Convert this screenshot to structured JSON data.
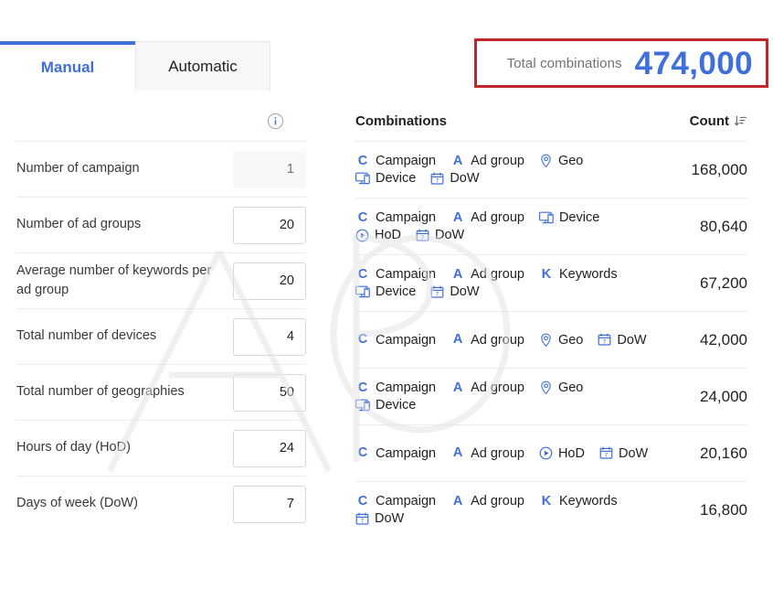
{
  "tabs": [
    {
      "label": "Manual",
      "active": true
    },
    {
      "label": "Automatic",
      "active": false
    }
  ],
  "summary": {
    "label": "Total combinations",
    "value": "474,000",
    "accent_color": "#3f6fd8",
    "highlight_border_color": "#c0272d"
  },
  "form": {
    "info_icon": "info-icon",
    "rows": [
      {
        "label": "Number of campaign",
        "value": "1",
        "readonly": true
      },
      {
        "label": "Number of ad groups",
        "value": "20",
        "readonly": false
      },
      {
        "label": "Average number of keywords per ad group",
        "value": "20",
        "readonly": false
      },
      {
        "label": "Total number of devices",
        "value": "4",
        "readonly": false
      },
      {
        "label": "Total number of geographies",
        "value": "50",
        "readonly": false
      },
      {
        "label": "Hours of day (HoD)",
        "value": "24",
        "readonly": false
      },
      {
        "label": "Days of week (DoW)",
        "value": "7",
        "readonly": false
      }
    ]
  },
  "table": {
    "columns": {
      "combinations": "Combinations",
      "count": "Count",
      "sort_icon": "sort-descending-icon"
    },
    "rows": [
      {
        "chips": [
          {
            "icon": "campaign-icon",
            "label": "Campaign"
          },
          {
            "icon": "ad-group-icon",
            "label": "Ad group"
          },
          {
            "icon": "geo-icon",
            "label": "Geo"
          },
          {
            "icon": "device-icon",
            "label": "Device"
          },
          {
            "icon": "dow-icon",
            "label": "DoW"
          }
        ],
        "count": "168,000"
      },
      {
        "chips": [
          {
            "icon": "campaign-icon",
            "label": "Campaign"
          },
          {
            "icon": "ad-group-icon",
            "label": "Ad group"
          },
          {
            "icon": "device-icon",
            "label": "Device"
          },
          {
            "icon": "hod-icon",
            "label": "HoD"
          },
          {
            "icon": "dow-icon",
            "label": "DoW"
          }
        ],
        "count": "80,640"
      },
      {
        "chips": [
          {
            "icon": "campaign-icon",
            "label": "Campaign"
          },
          {
            "icon": "ad-group-icon",
            "label": "Ad group"
          },
          {
            "icon": "keywords-icon",
            "label": "Keywords"
          },
          {
            "icon": "device-icon",
            "label": "Device"
          },
          {
            "icon": "dow-icon",
            "label": "DoW"
          }
        ],
        "count": "67,200"
      },
      {
        "chips": [
          {
            "icon": "campaign-icon",
            "label": "Campaign"
          },
          {
            "icon": "ad-group-icon",
            "label": "Ad group"
          },
          {
            "icon": "geo-icon",
            "label": "Geo"
          },
          {
            "icon": "dow-icon",
            "label": "DoW"
          }
        ],
        "count": "42,000"
      },
      {
        "chips": [
          {
            "icon": "campaign-icon",
            "label": "Campaign"
          },
          {
            "icon": "ad-group-icon",
            "label": "Ad group"
          },
          {
            "icon": "geo-icon",
            "label": "Geo"
          },
          {
            "icon": "device-icon",
            "label": "Device"
          }
        ],
        "count": "24,000"
      },
      {
        "chips": [
          {
            "icon": "campaign-icon",
            "label": "Campaign"
          },
          {
            "icon": "ad-group-icon",
            "label": "Ad group"
          },
          {
            "icon": "hod-icon",
            "label": "HoD"
          },
          {
            "icon": "dow-icon",
            "label": "DoW"
          }
        ],
        "count": "20,160"
      },
      {
        "chips": [
          {
            "icon": "campaign-icon",
            "label": "Campaign"
          },
          {
            "icon": "ad-group-icon",
            "label": "Ad group"
          },
          {
            "icon": "keywords-icon",
            "label": "Keywords"
          },
          {
            "icon": "dow-icon",
            "label": "DoW"
          }
        ],
        "count": "16,800"
      }
    ]
  }
}
